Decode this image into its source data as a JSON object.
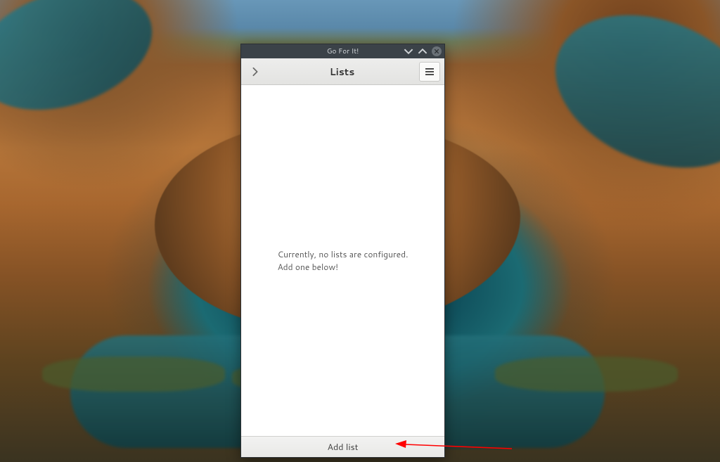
{
  "window": {
    "title": "Go For It!"
  },
  "header": {
    "title": "Lists"
  },
  "empty_state": {
    "line1": "Currently, no lists are configured.",
    "line2": "Add one below!"
  },
  "footer": {
    "add_list_label": "Add list"
  }
}
